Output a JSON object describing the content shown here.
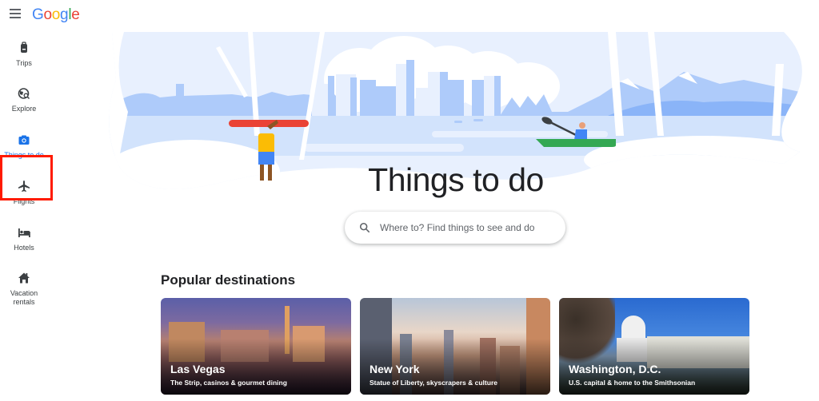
{
  "header": {
    "menu_icon": "hamburger-menu-icon",
    "logo_letters": [
      {
        "char": "G",
        "color": "#4285f4"
      },
      {
        "char": "o",
        "color": "#ea4335"
      },
      {
        "char": "o",
        "color": "#fbbc05"
      },
      {
        "char": "g",
        "color": "#4285f4"
      },
      {
        "char": "l",
        "color": "#34a853"
      },
      {
        "char": "e",
        "color": "#ea4335"
      }
    ]
  },
  "sidebar": {
    "items": [
      {
        "label": "Trips",
        "icon": "luggage-icon",
        "active": false
      },
      {
        "label": "Explore",
        "icon": "explore-globe-icon",
        "active": false
      },
      {
        "label": "Things to do",
        "icon": "camera-icon",
        "active": true
      },
      {
        "label": "Flights",
        "icon": "airplane-icon",
        "active": false
      },
      {
        "label": "Hotels",
        "icon": "bed-icon",
        "active": false
      },
      {
        "label": "Vacation rentals",
        "icon": "house-icon",
        "active": false
      }
    ],
    "highlight_color": "#ff1a00",
    "active_color": "#1a73e8"
  },
  "main": {
    "title": "Things to do",
    "search": {
      "placeholder": "Where to? Find things to see and do",
      "value": ""
    },
    "popular_title": "Popular destinations",
    "destinations": [
      {
        "name": "Las Vegas",
        "description": "The Strip, casinos & gourmet dining"
      },
      {
        "name": "New York",
        "description": "Statue of Liberty, skyscrapers & culture"
      },
      {
        "name": "Washington, D.C.",
        "description": "U.S. capital & home to the Smithsonian"
      }
    ]
  }
}
